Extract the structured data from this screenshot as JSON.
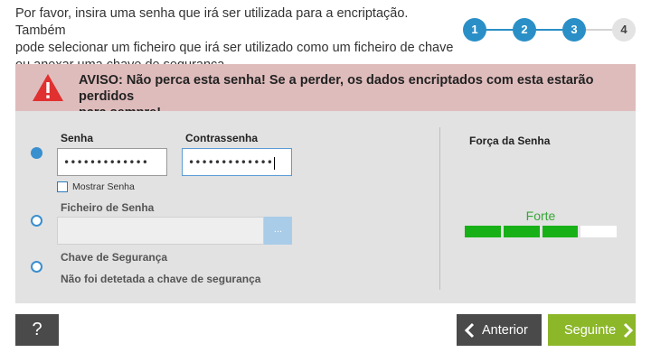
{
  "intro": {
    "line1": "Por favor, insira uma senha que irá ser utilizada para a encriptação. Também",
    "line2": "pode selecionar um ficheiro que irá ser utilizado como um ficheiro de chave",
    "line3": "ou anexar uma chave de segurança."
  },
  "steps": [
    {
      "label": "1",
      "state": "done"
    },
    {
      "label": "2",
      "state": "done"
    },
    {
      "label": "3",
      "state": "current"
    },
    {
      "label": "4",
      "state": "todo"
    }
  ],
  "warning": {
    "icon": "warning-icon",
    "line1": "AVISO: Não perca esta senha! Se a perder, os dados encriptados com esta estarão perdidos",
    "line2": "para sempre!"
  },
  "password": {
    "selected": true,
    "label": "Senha",
    "value": "•••••••••••••",
    "confirm_label": "Contrassenha",
    "confirm_value": "•••••••••••••",
    "show_label": "Mostrar Senha",
    "show_checked": false
  },
  "keyfile": {
    "selected": false,
    "label": "Ficheiro de Senha",
    "value": "",
    "browse_label": "..."
  },
  "security_key": {
    "selected": false,
    "label": "Chave de Segurança",
    "status": "Não foi detetada a chave de segurança"
  },
  "strength": {
    "title": "Força da Senha",
    "value_label": "Forte",
    "level": 3,
    "max": 4
  },
  "buttons": {
    "help": "?",
    "prev": "Anterior",
    "next": "Seguinte"
  },
  "colors": {
    "accent": "#2a8fc7",
    "warning_bg": "#dfbcbc",
    "strength_green": "#17b117",
    "next_btn": "#8cb729",
    "dark_btn": "#4a4a4a"
  }
}
